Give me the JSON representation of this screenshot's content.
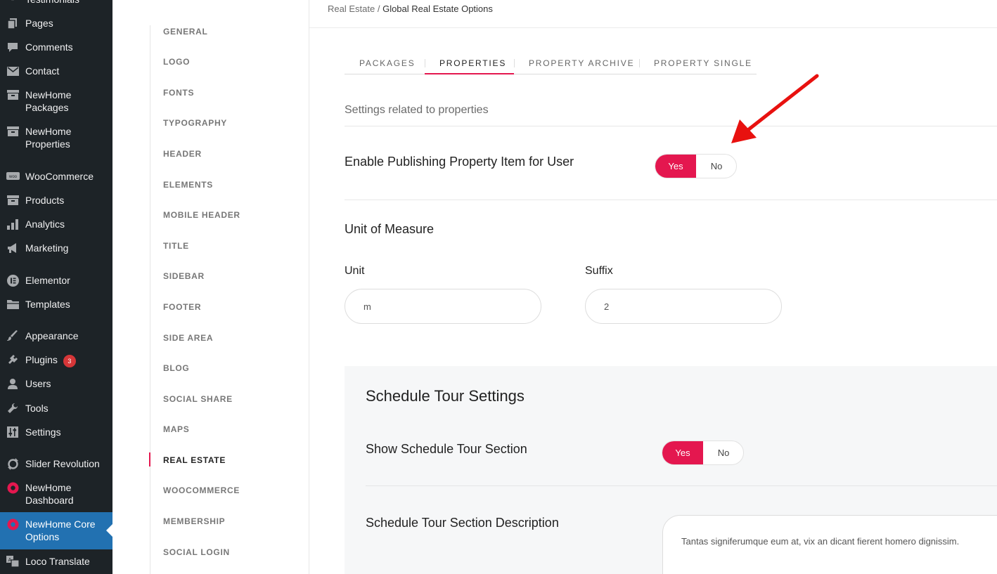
{
  "wp_sidebar": {
    "items": [
      {
        "label": "Testimonials",
        "icon": "testimonials-icon"
      },
      {
        "label": "Pages",
        "icon": "pages-icon"
      },
      {
        "label": "Comments",
        "icon": "comments-icon"
      },
      {
        "label": "Contact",
        "icon": "mail-icon"
      },
      {
        "label": "NewHome Packages",
        "icon": "archive-icon"
      },
      {
        "label": "NewHome Properties",
        "icon": "archive-icon"
      },
      {
        "label": "WooCommerce",
        "icon": "woocommerce-icon"
      },
      {
        "label": "Products",
        "icon": "archive-icon"
      },
      {
        "label": "Analytics",
        "icon": "bar-chart-icon"
      },
      {
        "label": "Marketing",
        "icon": "megaphone-icon"
      },
      {
        "label": "Elementor",
        "icon": "elementor-icon"
      },
      {
        "label": "Templates",
        "icon": "folder-icon"
      },
      {
        "label": "Appearance",
        "icon": "paintbrush-icon"
      },
      {
        "label": "Plugins",
        "icon": "plugin-icon",
        "badge": "3"
      },
      {
        "label": "Users",
        "icon": "user-icon"
      },
      {
        "label": "Tools",
        "icon": "wrench-icon"
      },
      {
        "label": "Settings",
        "icon": "sliders-icon"
      },
      {
        "label": "Slider Revolution",
        "icon": "refresh-icon"
      },
      {
        "label": "NewHome Dashboard",
        "icon": "newhome-icon"
      },
      {
        "label": "NewHome Core Options",
        "icon": "newhome-icon",
        "active": true
      },
      {
        "label": "Loco Translate",
        "icon": "translate-icon"
      }
    ]
  },
  "options_nav": {
    "items": [
      "GENERAL",
      "LOGO",
      "FONTS",
      "TYPOGRAPHY",
      "HEADER",
      "ELEMENTS",
      "MOBILE HEADER",
      "TITLE",
      "SIDEBAR",
      "FOOTER",
      "SIDE AREA",
      "BLOG",
      "SOCIAL SHARE",
      "MAPS",
      "REAL ESTATE",
      "WOOCOMMERCE",
      "MEMBERSHIP",
      "SOCIAL LOGIN"
    ],
    "active": "REAL ESTATE"
  },
  "breadcrumb": {
    "parent": "Real Estate",
    "separator": "/",
    "current": "Global Real Estate Options"
  },
  "tabs": [
    "PACKAGES",
    "PROPERTIES",
    "PROPERTY ARCHIVE",
    "PROPERTY SINGLE"
  ],
  "active_tab": "PROPERTIES",
  "properties": {
    "subtitle": "Settings related to properties",
    "enable_publishing": {
      "label": "Enable Publishing Property Item for User",
      "yes": "Yes",
      "no": "No",
      "value": "Yes"
    },
    "unit_of_measure": {
      "title": "Unit of Measure",
      "unit_label": "Unit",
      "unit_value": "m",
      "suffix_label": "Suffix",
      "suffix_value": "2"
    }
  },
  "schedule_tour": {
    "title": "Schedule Tour Settings",
    "show_section": {
      "label": "Show Schedule Tour Section",
      "yes": "Yes",
      "no": "No",
      "value": "Yes"
    },
    "description": {
      "label": "Schedule Tour Section Description",
      "value": "Tantas signiferumque eum at, vix an dicant fierent homero dignissim."
    }
  },
  "colors": {
    "accent": "#e4174f",
    "wp_sidebar_bg": "#1d2327",
    "wp_active": "#2271b1",
    "annotation_arrow": "#e8110f"
  }
}
